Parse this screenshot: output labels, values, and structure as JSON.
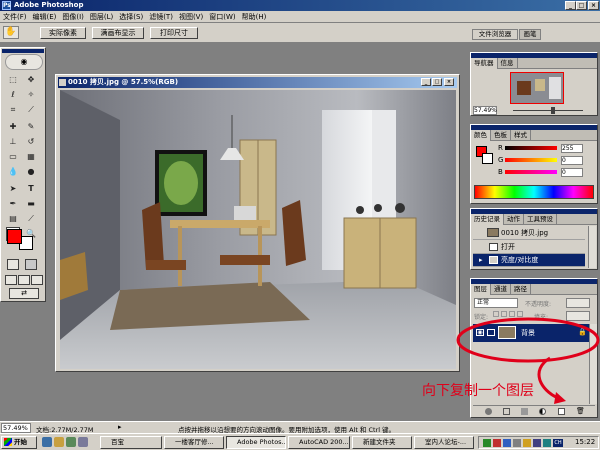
{
  "app": {
    "title": "Adobe Photoshop",
    "logo": "Ps"
  },
  "window_buttons": [
    "_",
    "□",
    "×"
  ],
  "menu": [
    "文件(F)",
    "编辑(E)",
    "图像(I)",
    "图层(L)",
    "选择(S)",
    "滤镜(T)",
    "视图(V)",
    "窗口(W)",
    "帮助(H)"
  ],
  "options": {
    "btn_actual": "实际像素",
    "btn_fit": "满画布显示",
    "btn_print": "打印尺寸",
    "tab_browser": "文件浏览器",
    "tab_brushes": "画笔"
  },
  "document": {
    "title": "0010 拷贝.jpg @ 57.5%(RGB)"
  },
  "navigator": {
    "tab_nav": "导航器",
    "tab_info": "信息",
    "zoom": "57.49%"
  },
  "color": {
    "tab_color": "颜色",
    "tab_swatch": "色板",
    "tab_style": "样式",
    "r_label": "R",
    "g_label": "G",
    "b_label": "B",
    "r": "255",
    "g": "0",
    "b": "0",
    "fg": "#ff0000"
  },
  "history": {
    "tab_history": "历史记录",
    "tab_actions": "动作",
    "tab_preset": "工具预设",
    "snapshot": "0010 拷贝.jpg",
    "items": [
      "打开",
      "亮度/对比度"
    ]
  },
  "layers": {
    "tab_layers": "图层",
    "tab_channels": "通道",
    "tab_paths": "路径",
    "mode": "正常",
    "opacity_label": "不透明度:",
    "lock_label": "锁定:",
    "fill_label": "填充:",
    "layer_name": "背景"
  },
  "annotation": {
    "text": "向下复制一个图层",
    "color": "#e0001a"
  },
  "status": {
    "zoom": "57.49%",
    "doc": "文档:2.77M/2.77M",
    "hint": "点按并拖移以沿想要的方向滚动图像。要用附加选项，使用 Alt 和 Ctrl 键。"
  },
  "taskbar": {
    "start": "开始",
    "items": [
      "百宝",
      "一楼客厅修...",
      "Adobe Photos...",
      "AutoCAD 200...",
      "新建文件夹",
      "室内人论坛-..."
    ],
    "clock": "15:22"
  }
}
